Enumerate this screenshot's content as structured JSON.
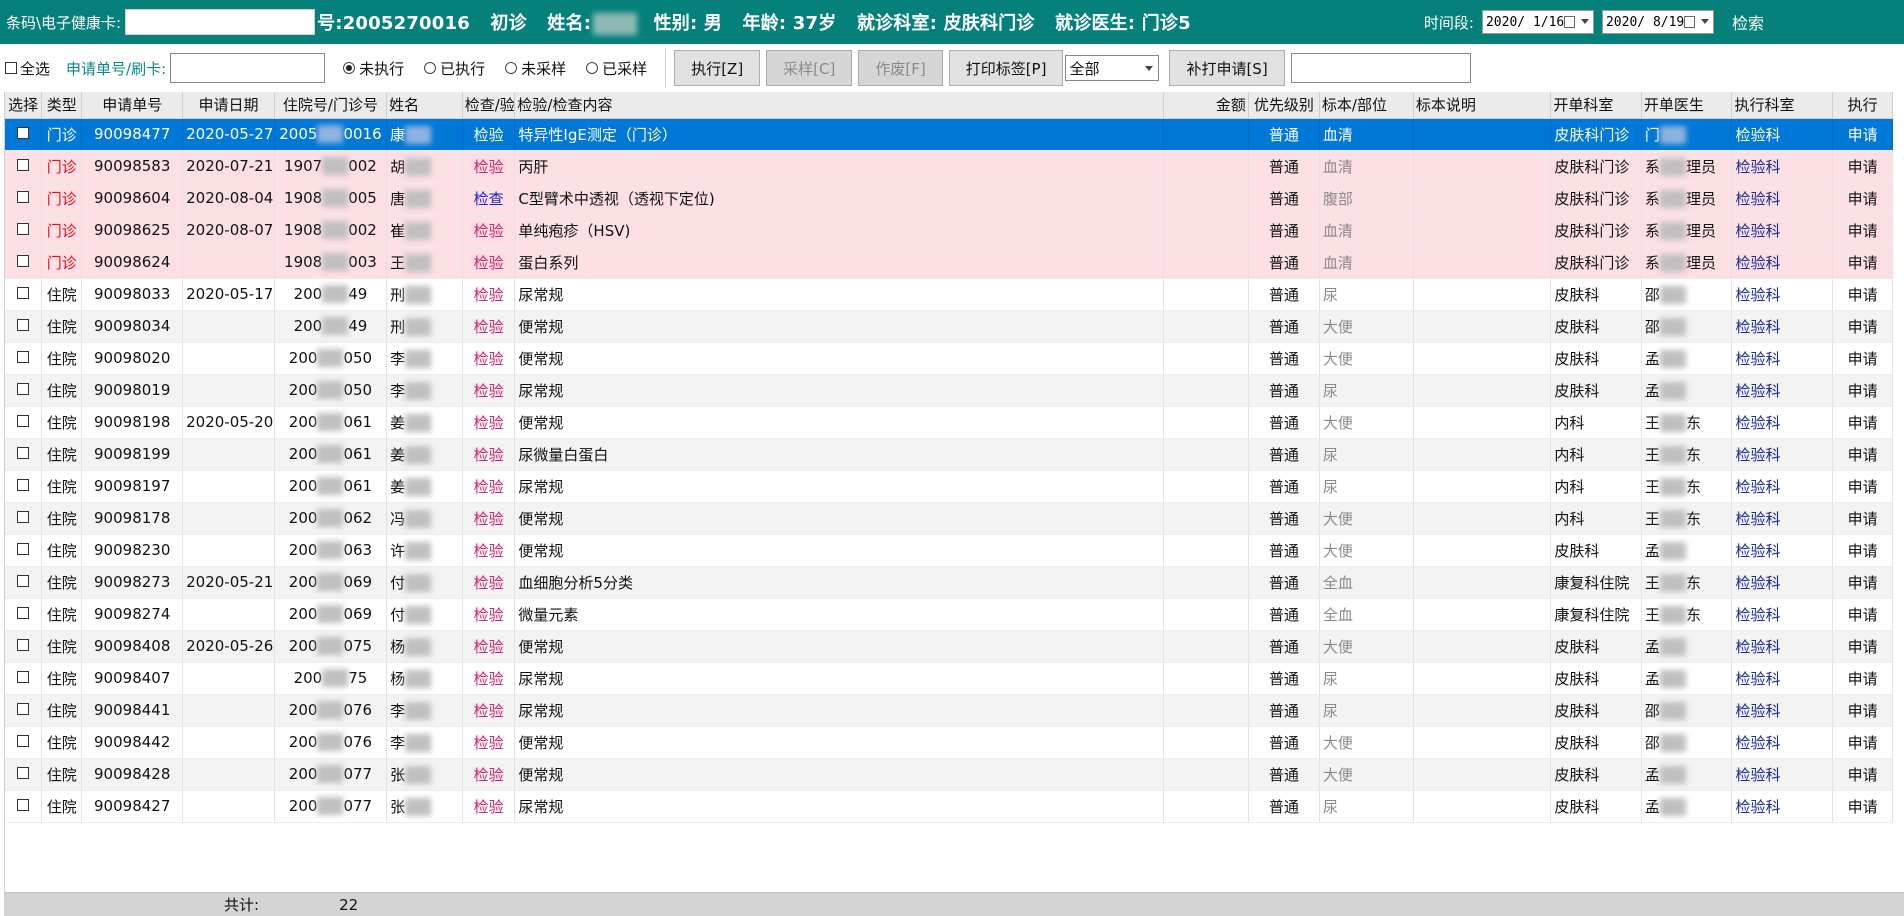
{
  "header": {
    "card_label": "条码\\电子健康卡:",
    "card_value": "",
    "no_suffix": "号:2005270016",
    "visit_type": "初诊",
    "name_label": "姓名:",
    "gender": "性别: 男",
    "age": "年龄: 37岁",
    "dept": "就诊科室: 皮肤科门诊",
    "doctor": "就诊医生: 门诊5",
    "time_label": "时间段:",
    "date_from": "2020/ 1/16",
    "date_to": "2020/ 8/19",
    "search": "检索"
  },
  "toolbar": {
    "select_all": "全选",
    "apply_label": "申请单号/刷卡:",
    "apply_value": "",
    "radios": [
      "未执行",
      "已执行",
      "未采样",
      "已采样"
    ],
    "btn_exec": "执行[Z]",
    "btn_sample": "采样[C]",
    "btn_void": "作废[F]",
    "btn_print": "打印标签[P]",
    "filter_value": "全部",
    "btn_reprint": "补打申请[S]",
    "extra_value": ""
  },
  "columns": [
    "选择",
    "类型",
    "申请单号",
    "申请日期",
    "住院号/门诊号",
    "姓名",
    "检查/验",
    "检验/检查内容",
    "金额",
    "优先级别",
    "标本/部位",
    "标本说明",
    "开单科室",
    "开单医生",
    "执行科室",
    "执行"
  ],
  "rows": [
    {
      "type": "门诊",
      "no": "90098477",
      "date": "2020-05-27",
      "pid_a": "2005",
      "pid_b": "0016",
      "name": "康",
      "kind": "检验",
      "content": "特异性IgE测定（门诊）",
      "priority": "普通",
      "specimen": "血清",
      "dept": "皮肤科门诊",
      "doctor_a": "门",
      "doctor_b": "",
      "exec_dept": "检验科",
      "exec": "申请"
    },
    {
      "type": "门诊",
      "no": "90098583",
      "date": "2020-07-21",
      "pid_a": "1907",
      "pid_b": "002",
      "name": "胡",
      "kind": "检验",
      "content": "丙肝",
      "priority": "普通",
      "specimen": "血清",
      "dept": "皮肤科门诊",
      "doctor_a": "系",
      "doctor_b": "理员",
      "exec_dept": "检验科",
      "exec": "申请"
    },
    {
      "type": "门诊",
      "no": "90098604",
      "date": "2020-08-04",
      "pid_a": "1908",
      "pid_b": "005",
      "name": "唐",
      "kind": "检查",
      "content": "C型臂术中透视（透视下定位)",
      "priority": "普通",
      "specimen": "腹部",
      "dept": "皮肤科门诊",
      "doctor_a": "系",
      "doctor_b": "理员",
      "exec_dept": "检验科",
      "exec": "申请"
    },
    {
      "type": "门诊",
      "no": "90098625",
      "date": "2020-08-07",
      "pid_a": "1908",
      "pid_b": "002",
      "name": "崔",
      "kind": "检验",
      "content": "单纯疱疹（HSV)",
      "priority": "普通",
      "specimen": "血清",
      "dept": "皮肤科门诊",
      "doctor_a": "系",
      "doctor_b": "理员",
      "exec_dept": "检验科",
      "exec": "申请"
    },
    {
      "type": "门诊",
      "no": "90098624",
      "date": "",
      "pid_a": "1908",
      "pid_b": "003",
      "name": "王",
      "kind": "检验",
      "content": "蛋白系列",
      "priority": "普通",
      "specimen": "血清",
      "dept": "皮肤科门诊",
      "doctor_a": "系",
      "doctor_b": "理员",
      "exec_dept": "检验科",
      "exec": "申请"
    },
    {
      "type": "住院",
      "no": "90098033",
      "date": "2020-05-17",
      "pid_a": "200",
      "pid_b": "49",
      "name": "刑",
      "kind": "检验",
      "content": "尿常规",
      "priority": "普通",
      "specimen": "尿",
      "dept": "皮肤科",
      "doctor_a": "邵",
      "doctor_b": "",
      "exec_dept": "检验科",
      "exec": "申请"
    },
    {
      "type": "住院",
      "no": "90098034",
      "date": "",
      "pid_a": "200",
      "pid_b": "49",
      "name": "刑",
      "kind": "检验",
      "content": "便常规",
      "priority": "普通",
      "specimen": "大便",
      "dept": "皮肤科",
      "doctor_a": "邵",
      "doctor_b": "",
      "exec_dept": "检验科",
      "exec": "申请"
    },
    {
      "type": "住院",
      "no": "90098020",
      "date": "",
      "pid_a": "200",
      "pid_b": "050",
      "name": "李",
      "kind": "检验",
      "content": "便常规",
      "priority": "普通",
      "specimen": "大便",
      "dept": "皮肤科",
      "doctor_a": "孟",
      "doctor_b": "",
      "exec_dept": "检验科",
      "exec": "申请"
    },
    {
      "type": "住院",
      "no": "90098019",
      "date": "",
      "pid_a": "200",
      "pid_b": "050",
      "name": "李",
      "kind": "检验",
      "content": "尿常规",
      "priority": "普通",
      "specimen": "尿",
      "dept": "皮肤科",
      "doctor_a": "孟",
      "doctor_b": "",
      "exec_dept": "检验科",
      "exec": "申请"
    },
    {
      "type": "住院",
      "no": "90098198",
      "date": "2020-05-20",
      "pid_a": "200",
      "pid_b": "061",
      "name": "姜",
      "kind": "检验",
      "content": "便常规",
      "priority": "普通",
      "specimen": "大便",
      "dept": "内科",
      "doctor_a": "王",
      "doctor_b": "东",
      "exec_dept": "检验科",
      "exec": "申请"
    },
    {
      "type": "住院",
      "no": "90098199",
      "date": "",
      "pid_a": "200",
      "pid_b": "061",
      "name": "姜",
      "kind": "检验",
      "content": "尿微量白蛋白",
      "priority": "普通",
      "specimen": "尿",
      "dept": "内科",
      "doctor_a": "王",
      "doctor_b": "东",
      "exec_dept": "检验科",
      "exec": "申请"
    },
    {
      "type": "住院",
      "no": "90098197",
      "date": "",
      "pid_a": "200",
      "pid_b": "061",
      "name": "姜",
      "kind": "检验",
      "content": "尿常规",
      "priority": "普通",
      "specimen": "尿",
      "dept": "内科",
      "doctor_a": "王",
      "doctor_b": "东",
      "exec_dept": "检验科",
      "exec": "申请"
    },
    {
      "type": "住院",
      "no": "90098178",
      "date": "",
      "pid_a": "200",
      "pid_b": "062",
      "name": "冯",
      "kind": "检验",
      "content": "便常规",
      "priority": "普通",
      "specimen": "大便",
      "dept": "内科",
      "doctor_a": "王",
      "doctor_b": "东",
      "exec_dept": "检验科",
      "exec": "申请"
    },
    {
      "type": "住院",
      "no": "90098230",
      "date": "",
      "pid_a": "200",
      "pid_b": "063",
      "name": "许",
      "kind": "检验",
      "content": "便常规",
      "priority": "普通",
      "specimen": "大便",
      "dept": "皮肤科",
      "doctor_a": "孟",
      "doctor_b": "",
      "exec_dept": "检验科",
      "exec": "申请"
    },
    {
      "type": "住院",
      "no": "90098273",
      "date": "2020-05-21",
      "pid_a": "200",
      "pid_b": "069",
      "name": "付",
      "kind": "检验",
      "content": "血细胞分析5分类",
      "priority": "普通",
      "specimen": "全血",
      "dept": "康复科住院",
      "doctor_a": "王",
      "doctor_b": "东",
      "exec_dept": "检验科",
      "exec": "申请"
    },
    {
      "type": "住院",
      "no": "90098274",
      "date": "",
      "pid_a": "200",
      "pid_b": "069",
      "name": "付",
      "kind": "检验",
      "content": "微量元素",
      "priority": "普通",
      "specimen": "全血",
      "dept": "康复科住院",
      "doctor_a": "王",
      "doctor_b": "东",
      "exec_dept": "检验科",
      "exec": "申请"
    },
    {
      "type": "住院",
      "no": "90098408",
      "date": "2020-05-26",
      "pid_a": "200",
      "pid_b": "075",
      "name": "杨",
      "kind": "检验",
      "content": "便常规",
      "priority": "普通",
      "specimen": "大便",
      "dept": "皮肤科",
      "doctor_a": "孟",
      "doctor_b": "",
      "exec_dept": "检验科",
      "exec": "申请"
    },
    {
      "type": "住院",
      "no": "90098407",
      "date": "",
      "pid_a": "200",
      "pid_b": "75",
      "name": "杨",
      "kind": "检验",
      "content": "尿常规",
      "priority": "普通",
      "specimen": "尿",
      "dept": "皮肤科",
      "doctor_a": "孟",
      "doctor_b": "",
      "exec_dept": "检验科",
      "exec": "申请"
    },
    {
      "type": "住院",
      "no": "90098441",
      "date": "",
      "pid_a": "200",
      "pid_b": "076",
      "name": "李",
      "kind": "检验",
      "content": "尿常规",
      "priority": "普通",
      "specimen": "尿",
      "dept": "皮肤科",
      "doctor_a": "邵",
      "doctor_b": "",
      "exec_dept": "检验科",
      "exec": "申请"
    },
    {
      "type": "住院",
      "no": "90098442",
      "date": "",
      "pid_a": "200",
      "pid_b": "076",
      "name": "李",
      "kind": "检验",
      "content": "便常规",
      "priority": "普通",
      "specimen": "大便",
      "dept": "皮肤科",
      "doctor_a": "邵",
      "doctor_b": "",
      "exec_dept": "检验科",
      "exec": "申请"
    },
    {
      "type": "住院",
      "no": "90098428",
      "date": "",
      "pid_a": "200",
      "pid_b": "077",
      "name": "张",
      "kind": "检验",
      "content": "便常规",
      "priority": "普通",
      "specimen": "大便",
      "dept": "皮肤科",
      "doctor_a": "孟",
      "doctor_b": "",
      "exec_dept": "检验科",
      "exec": "申请"
    },
    {
      "type": "住院",
      "no": "90098427",
      "date": "",
      "pid_a": "200",
      "pid_b": "077",
      "name": "张",
      "kind": "检验",
      "content": "尿常规",
      "priority": "普通",
      "specimen": "尿",
      "dept": "皮肤科",
      "doctor_a": "孟",
      "doctor_b": "",
      "exec_dept": "检验科",
      "exec": "申请"
    }
  ],
  "footer": {
    "total_label": "共计:",
    "total_value": "22"
  },
  "colors": {
    "header_bg": "#06807b",
    "selected_row": "#0078d7",
    "outpatient_row": "#fde0e4",
    "outpatient_text": "#e0101a",
    "lab_text": "#d61f6e",
    "exam_text": "#1a22c8",
    "exec_dept_text": "#1a2a9a"
  }
}
